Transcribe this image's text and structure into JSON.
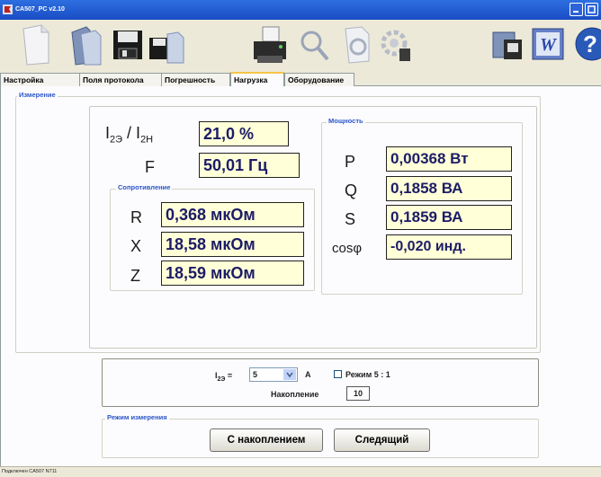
{
  "window": {
    "title": "CA507_PC v2.10"
  },
  "tabs": [
    {
      "label": "Настройка"
    },
    {
      "label": "Поля протокола"
    },
    {
      "label": "Погрешность"
    },
    {
      "label": "Нагрузка"
    },
    {
      "label": "Оборудование"
    }
  ],
  "measurement": {
    "group_label": "Измерение",
    "ratio": {
      "label_main": "I",
      "label_sub1": "2Э",
      "label_mid": " / I",
      "label_sub2": "2Н",
      "value": "21,0 %"
    },
    "freq": {
      "label": "F",
      "value": "50,01 Гц"
    },
    "resistance": {
      "group_label": "Сопротивление",
      "r": {
        "label": "R",
        "value": "0,368 мкОм"
      },
      "x": {
        "label": "X",
        "value": "18,58 мкОм"
      },
      "z": {
        "label": "Z",
        "value": "18,59 мкОм"
      }
    },
    "power": {
      "group_label": "Мощность",
      "p": {
        "label": "P",
        "value": "0,00368 Вт"
      },
      "q": {
        "label": "Q",
        "value": "0,1858 ВА"
      },
      "s": {
        "label": "S",
        "value": "0,1859 ВА"
      },
      "cos": {
        "label": "cosφ",
        "value": "-0,020 инд."
      }
    }
  },
  "settings": {
    "current_label_main": "I",
    "current_label_sub": "2Э",
    "current_label_eq": " =",
    "current_value": "5",
    "current_unit": "А",
    "mode_checkbox_label": "Режим 5 : 1",
    "mode_checked": false,
    "accumulation_label": "Накопление",
    "accumulation_value": "10"
  },
  "mode": {
    "group_label": "Режим измерения",
    "btn_accumulate": "С накоплением",
    "btn_follow": "Следящий"
  },
  "status": {
    "text": "Подключен CA507 N711"
  }
}
